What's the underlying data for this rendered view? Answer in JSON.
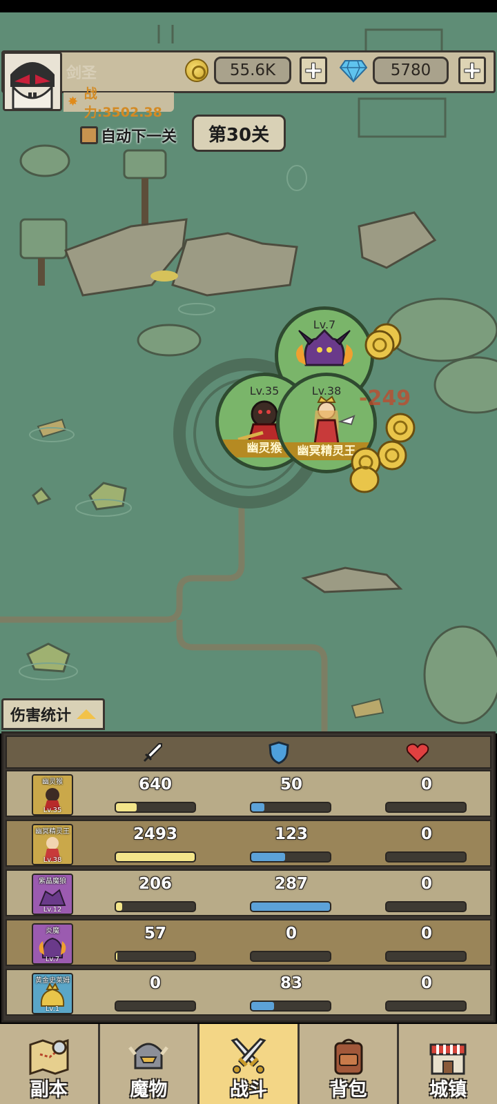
{
  "player": {
    "name": "剑圣",
    "power": "战力:3502.38"
  },
  "currency": {
    "gold": "55.6K",
    "gems": "5780",
    "add_label": "+"
  },
  "stage": {
    "auto_next_label": "自动下一关",
    "current": "第30关"
  },
  "battle": {
    "floating_damage": "-249",
    "units": [
      {
        "level": "Lv.7",
        "name": ""
      },
      {
        "level": "Lv.35",
        "name": "幽灵猴"
      },
      {
        "level": "Lv.38",
        "name": "幽冥精灵王"
      }
    ]
  },
  "damage_stats": {
    "tab_label": "伤害统计",
    "columns": [
      "sword-icon",
      "shield-icon",
      "heart-icon"
    ],
    "rows": [
      {
        "name": "幽灵猴",
        "level": "Lv.35",
        "attack": "640",
        "defense": "50",
        "heal": "0",
        "attack_pct": 0.26,
        "defense_pct": 0.17,
        "heal_pct": 0
      },
      {
        "name": "幽冥精灵王",
        "level": "Lv.38",
        "attack": "2493",
        "defense": "123",
        "heal": "0",
        "attack_pct": 1.0,
        "defense_pct": 0.43,
        "heal_pct": 0
      },
      {
        "name": "紫晶魔狼",
        "level": "Lv.12",
        "attack": "206",
        "defense": "287",
        "heal": "0",
        "attack_pct": 0.08,
        "defense_pct": 1.0,
        "heal_pct": 0
      },
      {
        "name": "炎魔",
        "level": "Lv.7",
        "attack": "57",
        "defense": "0",
        "heal": "0",
        "attack_pct": 0.02,
        "defense_pct": 0,
        "heal_pct": 0
      },
      {
        "name": "黄金史莱姆",
        "level": "Lv.1",
        "attack": "0",
        "defense": "83",
        "heal": "0",
        "attack_pct": 0,
        "defense_pct": 0.29,
        "heal_pct": 0
      }
    ]
  },
  "nav": [
    {
      "label": "副本",
      "icon": "map-icon",
      "active": false
    },
    {
      "label": "魔物",
      "icon": "helmet-icon",
      "active": false
    },
    {
      "label": "战斗",
      "icon": "crossed-swords-icon",
      "active": true
    },
    {
      "label": "背包",
      "icon": "backpack-icon",
      "active": false
    },
    {
      "label": "城镇",
      "icon": "shop-icon",
      "active": false
    }
  ],
  "colors": {
    "map_bg": "#5f8d76",
    "bar_attack": "#f3e58a",
    "bar_defense": "#5ca2d8",
    "nav_active": "#f3d686"
  }
}
